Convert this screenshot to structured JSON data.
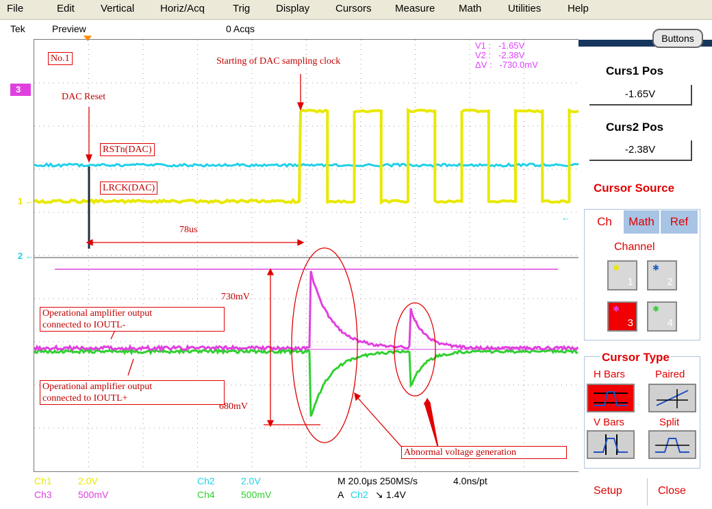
{
  "menu": [
    "File",
    "Edit",
    "Vertical",
    "Horiz/Acq",
    "Trig",
    "Display",
    "Cursors",
    "Measure",
    "Math",
    "Utilities",
    "Help"
  ],
  "status": {
    "brand": "Tek",
    "mode": "Preview",
    "acqs": "0 Acqs"
  },
  "annotations": {
    "no1": "No.1",
    "dac_clock": "Starting of DAC sampling clock",
    "dac_reset": "DAC Reset",
    "rstn": "RSTn(DAC)",
    "lrck": "LRCK(DAC)",
    "time": "78us",
    "mv730": "730mV",
    "mv680": "680mV",
    "op_minus": [
      "Operational amplifier output",
      "connected to IOUTL-"
    ],
    "op_plus": [
      "Operational amplifier output",
      "connected to IOUTL+"
    ],
    "abnormal": "Abnormal voltage generation"
  },
  "cursor_readout": {
    "v1_label": "V1 :",
    "v1": "-1.65V",
    "v2_label": "V2 :",
    "v2": "-2.38V",
    "dv_label": "ΔV :",
    "dv": "-730.0mV"
  },
  "channel_markers": {
    "ch3": "3",
    "ch1": "1",
    "ch2": "2"
  },
  "bottom": {
    "ch1": "Ch1",
    "ch1_scale": "2.0V",
    "ch2": "Ch2",
    "ch2_scale": "2.0V",
    "ch3": "Ch3",
    "ch3_scale": "500mV",
    "ch4": "Ch4",
    "ch4_scale": "500mV",
    "timebase": "M 20.0μs 250MS/s",
    "resolution": "4.0ns/pt",
    "trig_a": "A",
    "trig_ch": "Ch2",
    "trig_slope": "↘",
    "trig_level": "1.4V"
  },
  "panel": {
    "buttons": "Buttons",
    "curs1_title": "Curs1 Pos",
    "curs1_value": "-1.65V",
    "curs2_title": "Curs2 Pos",
    "curs2_value": "-2.38V",
    "cursor_source": "Cursor Source",
    "tabs": [
      "Ch",
      "Math",
      "Ref"
    ],
    "channel_label": "Channel",
    "channels": [
      "1",
      "2",
      "3",
      "4"
    ],
    "cursor_type": "Cursor Type",
    "types": [
      "H Bars",
      "Paired",
      "V Bars",
      "Split"
    ],
    "setup": "Setup",
    "close": "Close"
  },
  "colors": {
    "ch1": "#e8e800",
    "ch2": "#20d0e8",
    "ch3": "#e040e0",
    "ch4": "#30d030",
    "annot": "#e00000"
  }
}
